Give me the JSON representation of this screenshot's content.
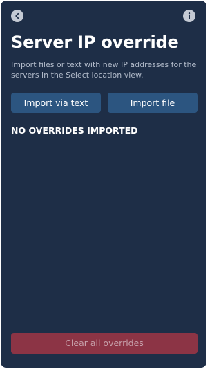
{
  "header": {
    "back_icon": "chevron-left-icon",
    "info_icon": "info-icon"
  },
  "page": {
    "title": "Server IP override",
    "description": "Import files or text with new IP addresses for the servers in the Select location view."
  },
  "actions": {
    "import_text_label": "Import via text",
    "import_file_label": "Import file"
  },
  "status": {
    "empty_label": "NO OVERRIDES IMPORTED"
  },
  "footer": {
    "clear_label": "Clear all overrides",
    "clear_disabled": true
  },
  "colors": {
    "background": "#1e2e47",
    "primary_button": "#2c5580",
    "destructive_button": "#8c3445",
    "icon_background": "#c4cad4"
  }
}
